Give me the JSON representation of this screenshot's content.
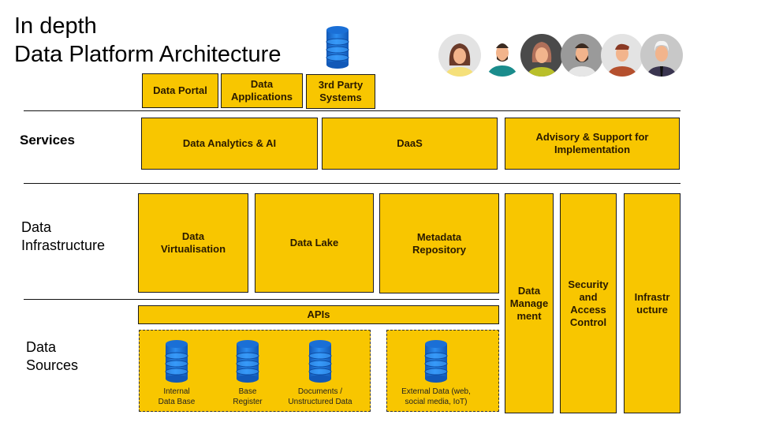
{
  "title": {
    "line1": "In depth",
    "line2": "Data Platform Architecture"
  },
  "icons": {
    "title_icon": "database-icon",
    "source_icon": "database-icon",
    "users": "user-avatars"
  },
  "colors": {
    "box_fill": "#F8C600",
    "box_border": "#1a1a1a",
    "database_blue": "#1a6fd6"
  },
  "users": [
    {
      "name": "user-woman-yellow"
    },
    {
      "name": "user-man-teal"
    },
    {
      "name": "user-woman-olive"
    },
    {
      "name": "user-man-bearded-grey"
    },
    {
      "name": "user-man-orange"
    },
    {
      "name": "user-elder-suit"
    }
  ],
  "consumers": [
    {
      "label": "Data Portal"
    },
    {
      "label": "Data\nApplications"
    },
    {
      "label": "3rd Party\nSystems"
    }
  ],
  "rows": {
    "services": "Services",
    "infrastructure": "Data\nInfrastructure",
    "sources": "Data\nSources"
  },
  "services": [
    {
      "label": "Data Analytics & AI"
    },
    {
      "label": "DaaS"
    },
    {
      "label": "Advisory & Support for\nImplementation"
    }
  ],
  "infrastructure": [
    {
      "label": "Data\nVirtualisation"
    },
    {
      "label": "Data Lake"
    },
    {
      "label": "Metadata\nRepository"
    }
  ],
  "apis": "APIs",
  "pillars": [
    {
      "label": "Data\nManage\nment"
    },
    {
      "label": "Security\nand\nAccess\nControl"
    },
    {
      "label": "Infrastr\nucture"
    }
  ],
  "sources": [
    {
      "label": "Internal\nData Base"
    },
    {
      "label": "Base\nRegister"
    },
    {
      "label": "Documents /\nUnstructured Data"
    },
    {
      "label": "External Data (web,\nsocial media, IoT)"
    }
  ]
}
